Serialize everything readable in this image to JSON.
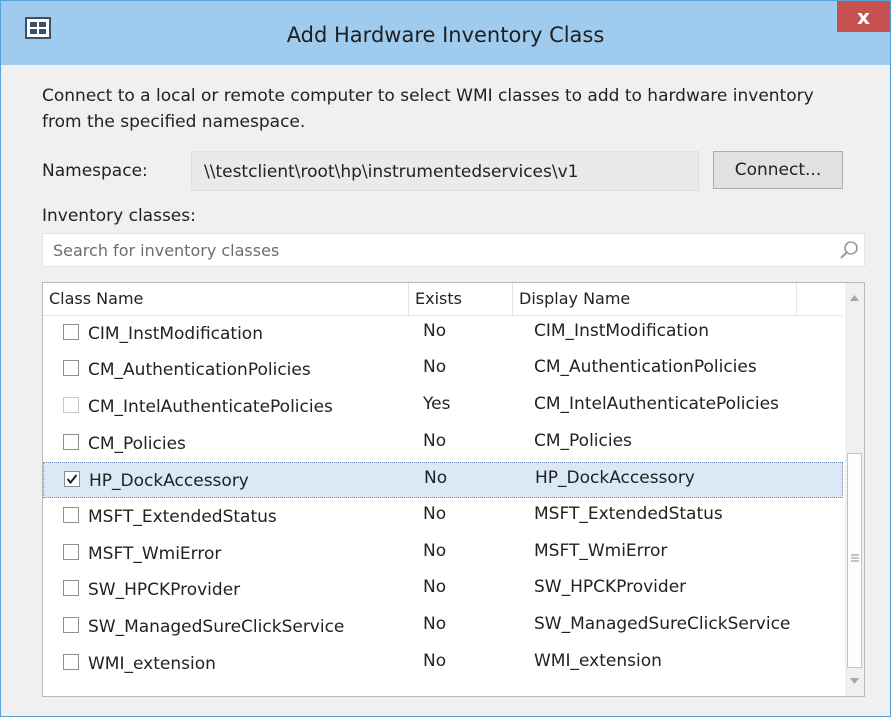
{
  "window": {
    "title": "Add Hardware Inventory Class",
    "close_label": "x"
  },
  "dialog": {
    "description": "Connect to a local or remote computer to select WMI classes to add to hardware inventory from the specified namespace.",
    "namespace_label": "Namespace:",
    "namespace_value": "\\\\testclient\\root\\hp\\instrumentedservices\\v1",
    "connect_label": "Connect...",
    "inventory_label": "Inventory classes:",
    "search_placeholder": "Search for inventory classes"
  },
  "table": {
    "columns": [
      "Class Name",
      "Exists",
      "Display Name"
    ],
    "rows": [
      {
        "class_name": "CIM_InstModification",
        "exists": "No",
        "display_name": "CIM_InstModification",
        "checked": false,
        "disabled": false
      },
      {
        "class_name": "CM_AuthenticationPolicies",
        "exists": "No",
        "display_name": "CM_AuthenticationPolicies",
        "checked": false,
        "disabled": false
      },
      {
        "class_name": "CM_IntelAuthenticatePolicies",
        "exists": "Yes",
        "display_name": "CM_IntelAuthenticatePolicies",
        "checked": false,
        "disabled": true
      },
      {
        "class_name": "CM_Policies",
        "exists": "No",
        "display_name": "CM_Policies",
        "checked": false,
        "disabled": false
      },
      {
        "class_name": "HP_DockAccessory",
        "exists": "No",
        "display_name": "HP_DockAccessory",
        "checked": true,
        "disabled": false,
        "selected": true
      },
      {
        "class_name": "MSFT_ExtendedStatus",
        "exists": "No",
        "display_name": "MSFT_ExtendedStatus",
        "checked": false,
        "disabled": false
      },
      {
        "class_name": "MSFT_WmiError",
        "exists": "No",
        "display_name": "MSFT_WmiError",
        "checked": false,
        "disabled": false
      },
      {
        "class_name": "SW_HPCKProvider",
        "exists": "No",
        "display_name": "SW_HPCKProvider",
        "checked": false,
        "disabled": false
      },
      {
        "class_name": "SW_ManagedSureClickService",
        "exists": "No",
        "display_name": "SW_ManagedSureClickService",
        "checked": false,
        "disabled": false
      },
      {
        "class_name": "WMI_extension",
        "exists": "No",
        "display_name": "WMI_extension",
        "checked": false,
        "disabled": false
      }
    ]
  },
  "icons": {
    "app": "app-window-icon",
    "search": "search-icon",
    "checkbox": "checkbox-icon",
    "scroll_up": "chevron-up-icon",
    "scroll_down": "chevron-down-icon"
  },
  "colors": {
    "titlebar": "#9fcbee",
    "close": "#c75050",
    "selection": "#dbe8f6"
  }
}
